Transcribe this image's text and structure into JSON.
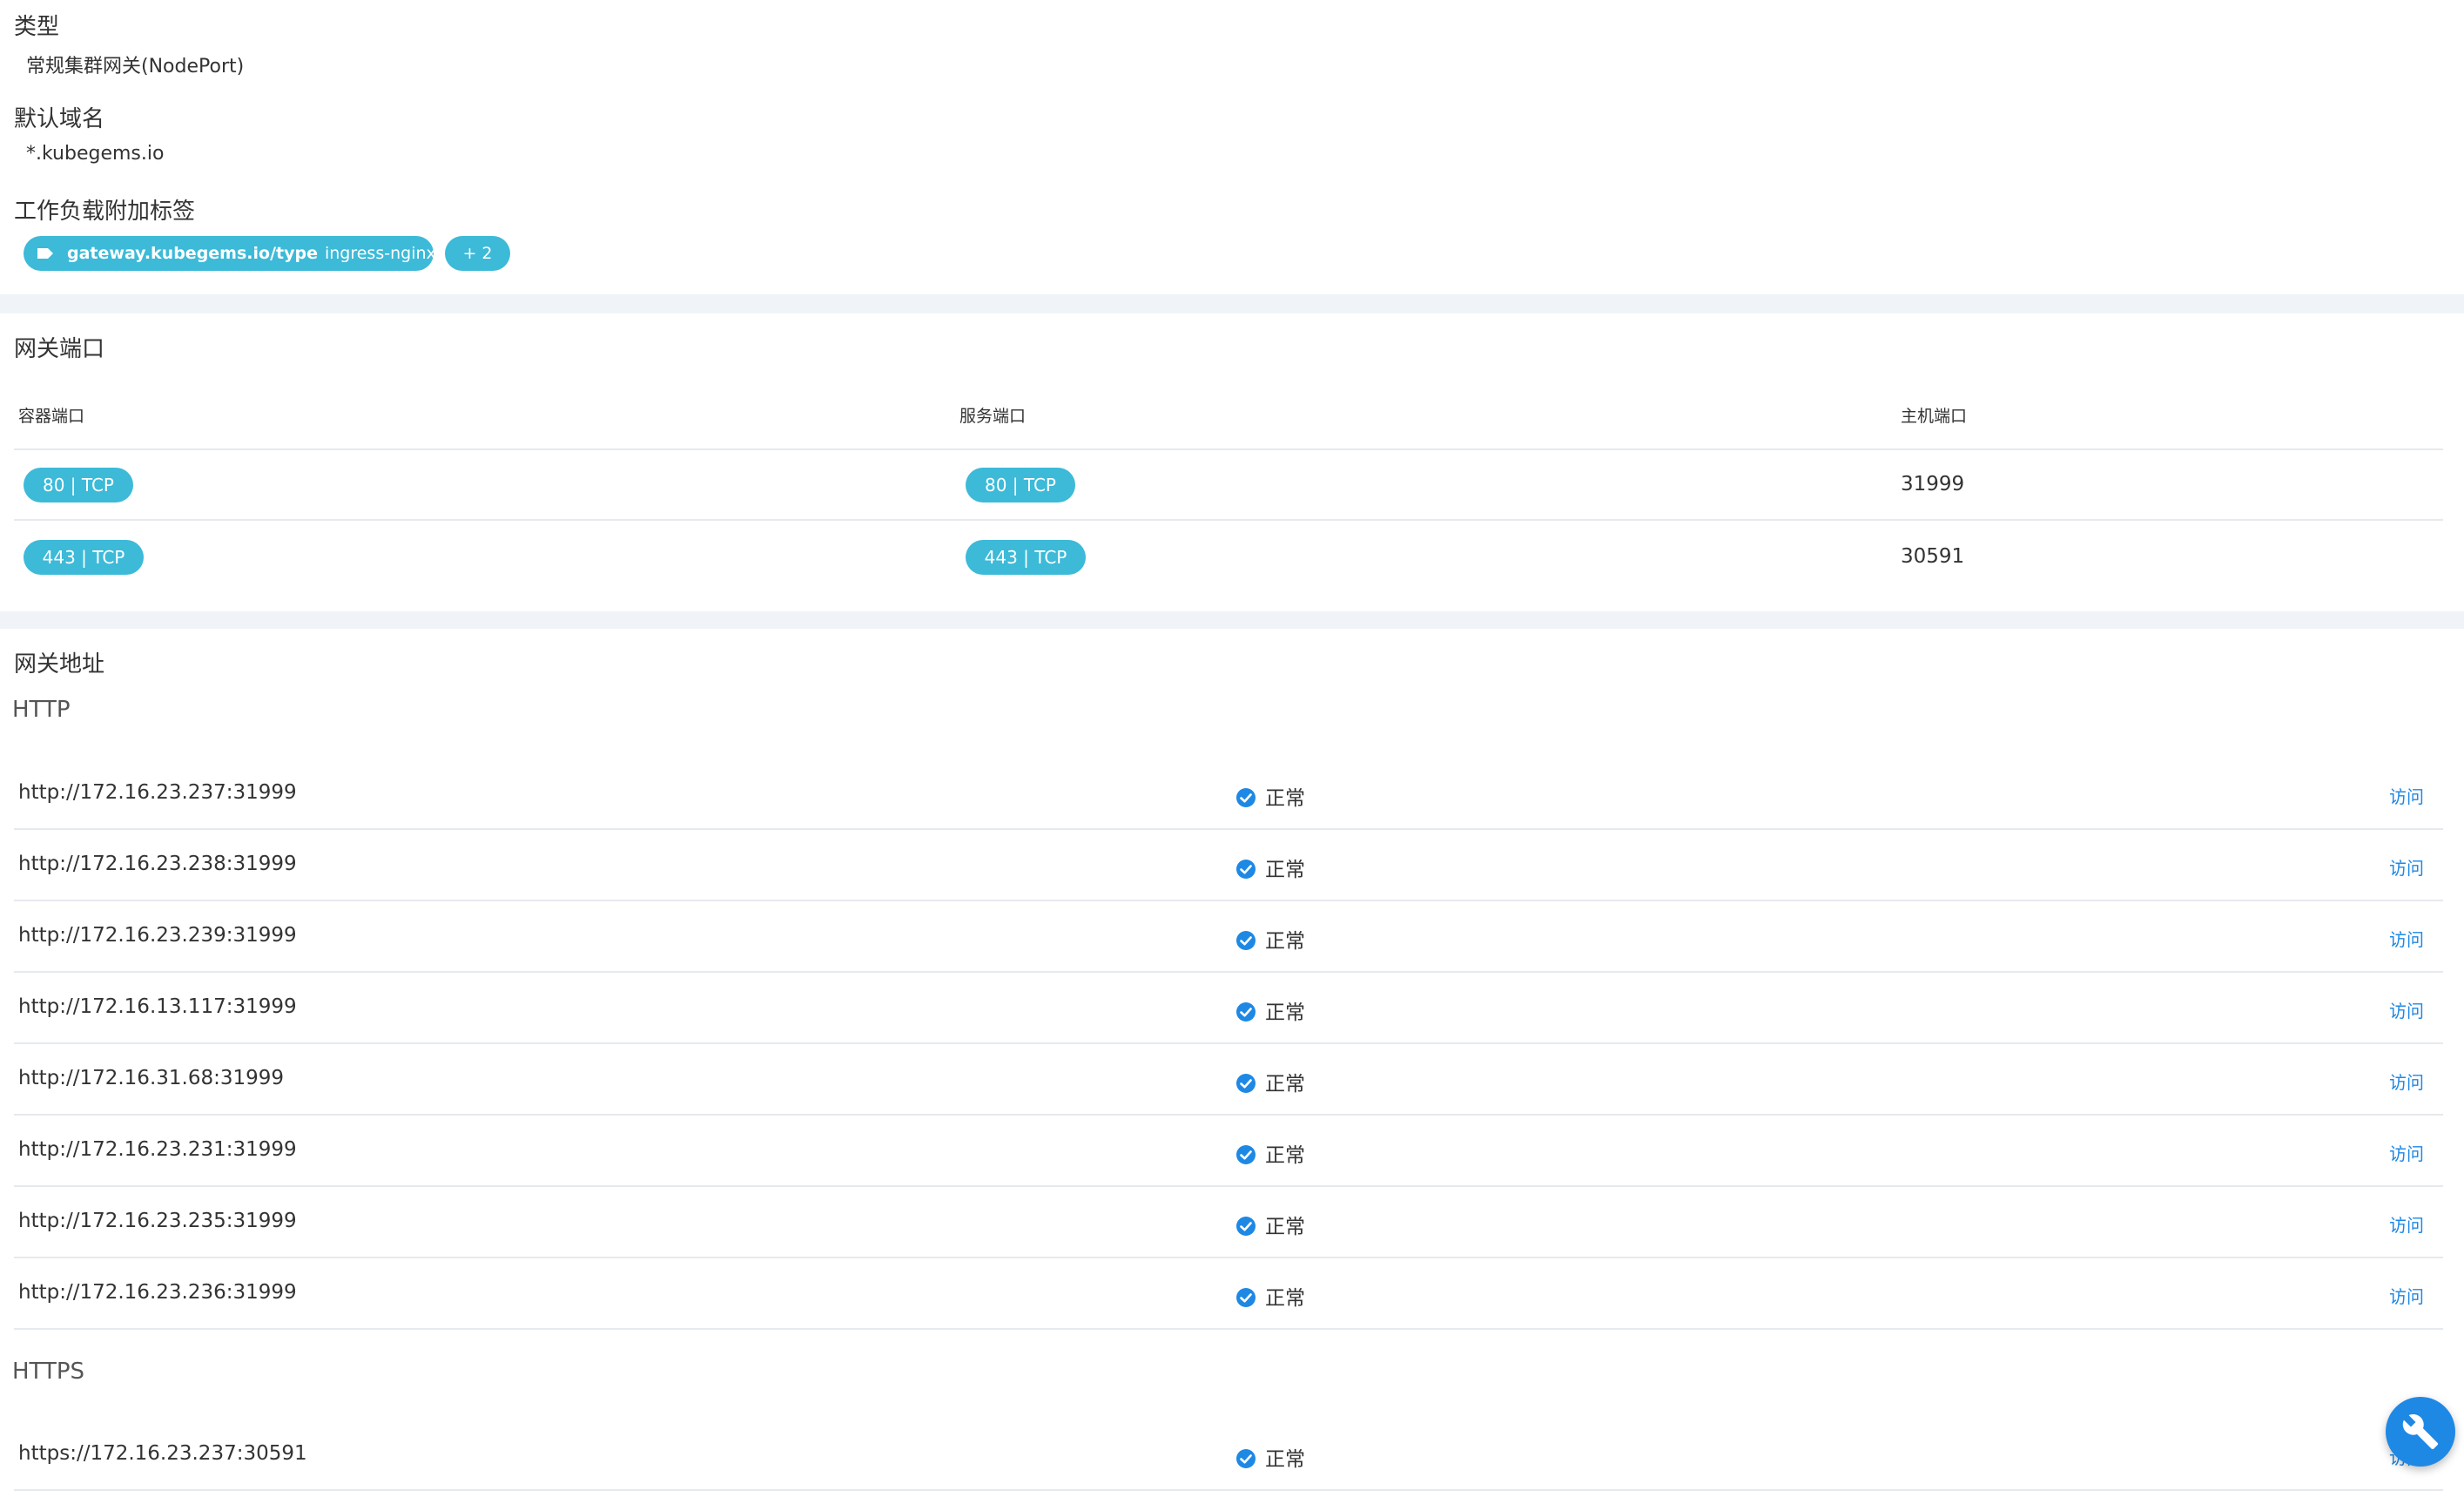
{
  "info": {
    "type_label": "类型",
    "type_value": "常规集群网关(NodePort)",
    "domain_label": "默认域名",
    "domain_value": "*.kubegems.io",
    "labels_label": "工作负载附加标签",
    "label_chip": {
      "key": "gateway.kubegems.io/type",
      "value": "ingress-nginx"
    },
    "more_chip": "+ 2"
  },
  "ports": {
    "title": "网关端口",
    "headers": [
      "容器端口",
      "服务端口",
      "主机端口"
    ],
    "rows": [
      {
        "container": "80 | TCP",
        "service": "80 | TCP",
        "host": "31999"
      },
      {
        "container": "443 | TCP",
        "service": "443 | TCP",
        "host": "30591"
      }
    ]
  },
  "addresses": {
    "title": "网关地址",
    "http_label": "HTTP",
    "https_label": "HTTPS",
    "status_text": "正常",
    "visit_text": "访问",
    "http": [
      "http://172.16.23.237:31999",
      "http://172.16.23.238:31999",
      "http://172.16.23.239:31999",
      "http://172.16.13.117:31999",
      "http://172.16.31.68:31999",
      "http://172.16.23.231:31999",
      "http://172.16.23.235:31999",
      "http://172.16.23.236:31999"
    ],
    "https": [
      "https://172.16.23.237:30591"
    ]
  },
  "colors": {
    "chip": "#3cbad8",
    "accent": "#1e88e5",
    "band": "#f0f4f8",
    "divider": "#e6e9ee"
  },
  "icons": {
    "tag": "tag-icon",
    "status_ok": "check-circle-icon",
    "fab": "wrench-icon"
  }
}
